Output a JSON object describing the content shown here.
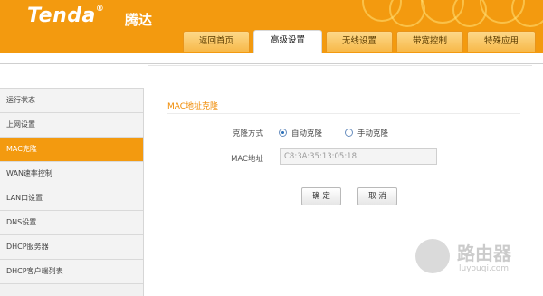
{
  "brand": {
    "logo": "Tenda",
    "logo_cn": "腾达",
    "accent": "#f39a0f"
  },
  "tabs": [
    {
      "label": "返回首页"
    },
    {
      "label": "高级设置",
      "active": true
    },
    {
      "label": "无线设置"
    },
    {
      "label": "带宽控制"
    },
    {
      "label": "特殊应用"
    }
  ],
  "sidebar": {
    "items": [
      {
        "label": "运行状态"
      },
      {
        "label": "上网设置"
      },
      {
        "label": "MAC克隆",
        "active": true
      },
      {
        "label": "WAN速率控制"
      },
      {
        "label": "LAN口设置"
      },
      {
        "label": "DNS设置"
      },
      {
        "label": "DHCP服务器"
      },
      {
        "label": "DHCP客户端列表"
      }
    ]
  },
  "main": {
    "section_title": "MAC地址克隆",
    "clone_mode_label": "克隆方式",
    "options": [
      {
        "label": "自动克隆",
        "selected": true
      },
      {
        "label": "手动克隆",
        "selected": false
      }
    ],
    "mac_label": "MAC地址",
    "mac_value": "C8:3A:35:13:05:18",
    "confirm_label": "确 定",
    "cancel_label": "取 消"
  },
  "watermark": {
    "text": "路由器",
    "sub": "luyouqi.com"
  }
}
